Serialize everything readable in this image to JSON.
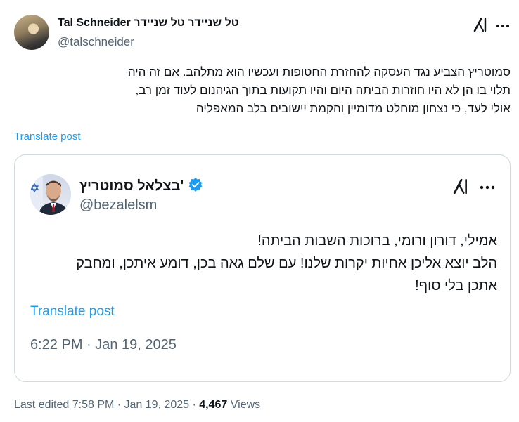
{
  "post": {
    "author_name": "Tal Schneider טל שניידר טל שנײדר",
    "author_handle": "@talschneider",
    "text_lines": [
      "סמוטריץ הצביע נגד העסקה להחזרת החטופות ועכשיו הוא מתלהב. אם זה היה",
      "תלוי בו הן לא היו חוזרות הביתה היום והיו תקועות בתוך הגיהנום לעוד זמן רב,",
      "אולי לעד, כי נצחון מוחלט מדומיין והקמת יישובים בלב המאפליה"
    ],
    "translate_label": "Translate post",
    "footer": {
      "edited": "Last edited 7:58 PM · Jan 19, 2025 ·",
      "views_count": "4,467",
      "views_label": "Views"
    }
  },
  "quote": {
    "author_name": "בצלאל סמוטריץ'",
    "author_handle": "@bezalelsm",
    "text_lines": [
      "אמילי, דורון ורומי, ברוכות השבות הביתה!",
      "הלב יוצא אליכן אחיות יקרות שלנו! עם שלם גאה בכן, דומע איתכן, ומחבק",
      "אתכן בלי סוף!"
    ],
    "translate_label": "Translate post",
    "timestamp": "6:22 PM · Jan 19, 2025"
  },
  "icons": {
    "grok": "grok-icon",
    "more": "more-icon",
    "verified": "verified-badge-icon"
  },
  "colors": {
    "link": "#1d9bf0",
    "secondary_text": "#536471",
    "border": "#cfd9de"
  }
}
